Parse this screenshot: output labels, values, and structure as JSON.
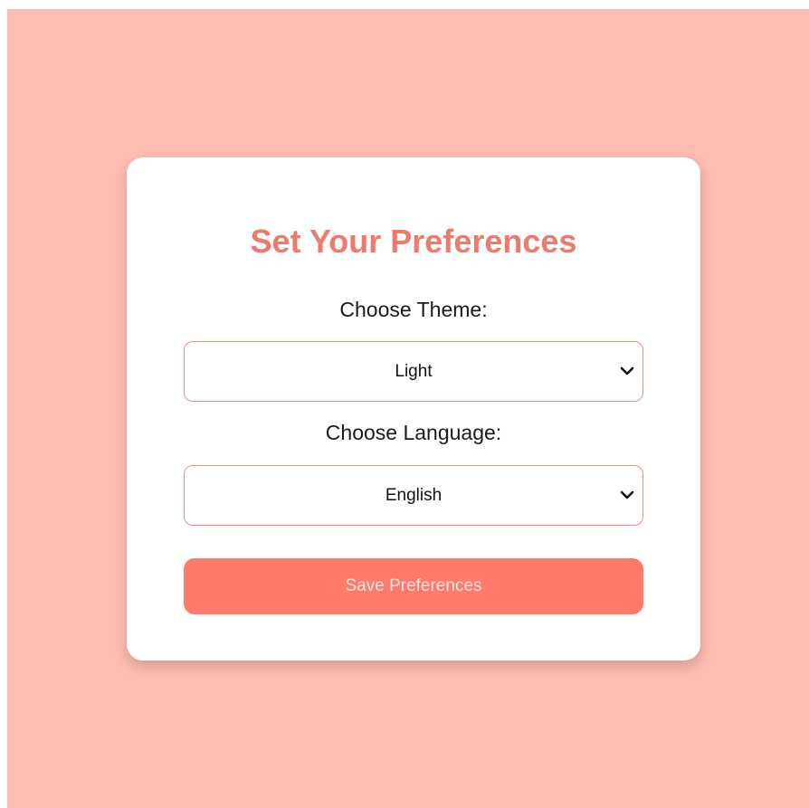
{
  "preferences": {
    "title": "Set Your Preferences",
    "theme": {
      "label": "Choose Theme:",
      "selected": "Light"
    },
    "language": {
      "label": "Choose Language:",
      "selected": "English"
    },
    "save_label": "Save Preferences"
  },
  "colors": {
    "background": "#ffbcb0",
    "card": "#ffffff",
    "title": "#ec7b6d",
    "select_border": "#e29488",
    "button": "#ff7a6a",
    "button_text": "#fde6e1"
  }
}
